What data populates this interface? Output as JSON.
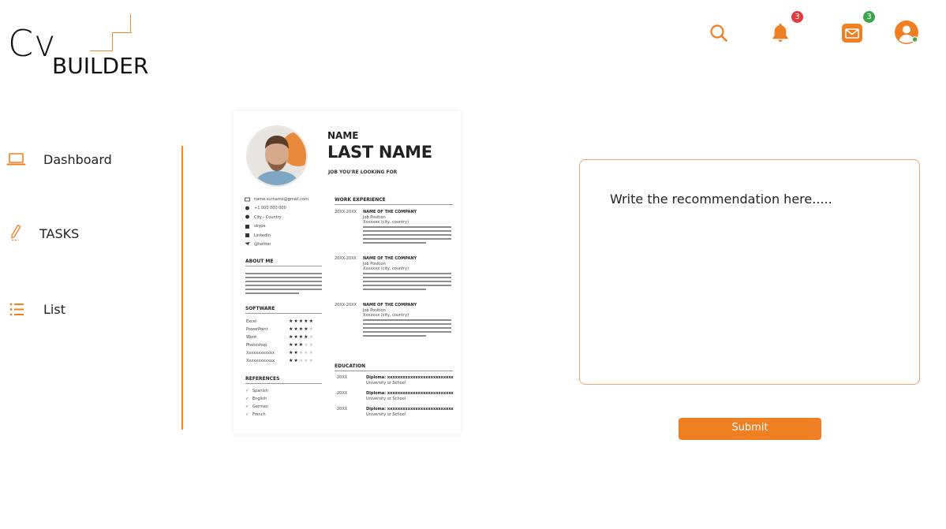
{
  "logo": {
    "text_main": "Cv",
    "text_sub": "BUILDER"
  },
  "header": {
    "notifications_count": "3",
    "messages_count": "3"
  },
  "sidebar": {
    "items": [
      {
        "label": "Dashboard",
        "icon": "laptop-icon"
      },
      {
        "label": "TASKS",
        "icon": "pencil-icon"
      },
      {
        "label": "List",
        "icon": "list-icon"
      }
    ]
  },
  "cv_preview": {
    "name": "NAME",
    "last_name": "LAST NAME",
    "job_title": "JOB YOU'RE LOOKING FOR",
    "contact": [
      "name.surname@gmail.com",
      "+1 000 000 000",
      "City - Country",
      "skype",
      "LinkedIn",
      "@twitter"
    ],
    "about_title": "ABOUT ME",
    "software_title": "SOFTWARE",
    "software": [
      {
        "name": "Excel",
        "stars": 5
      },
      {
        "name": "PowerPoint",
        "stars": 4
      },
      {
        "name": "Word",
        "stars": 4
      },
      {
        "name": "Photoshop",
        "stars": 3
      },
      {
        "name": "Xxxxxxxxxxxx",
        "stars": 2
      },
      {
        "name": "Xxxxxxxxxxxx",
        "stars": 2
      }
    ],
    "references_title": "REFERENCES",
    "references": [
      "Spanish",
      "English",
      "German",
      "French"
    ],
    "work_title": "WORK EXPERIENCE",
    "work_items": [
      {
        "date": "20XX-20XX",
        "company": "NAME OF THE COMPANY",
        "role": "Job Position",
        "place": "Xxxxxxx (city, country)"
      },
      {
        "date": "20XX-20XX",
        "company": "NAME OF THE COMPANY",
        "role": "Job Position",
        "place": "Xxxxxxx (city, country)"
      },
      {
        "date": "20XX-20XX",
        "company": "NAME OF THE COMPANY",
        "role": "Job Position",
        "place": "Xxxxxxx (city, country)"
      }
    ],
    "education_title": "EDUCATION",
    "education": [
      {
        "date": "20XX",
        "degree": "Diploma: xxxxxxxxxxxxxxxxxxxxxxxxxx",
        "school": "University or School"
      },
      {
        "date": "20XX",
        "degree": "Diploma: xxxxxxxxxxxxxxxxxxxxxxxxxx",
        "school": "University or School"
      },
      {
        "date": "20XX",
        "degree": "Diploma: xxxxxxxxxxxxxxxxxxxxxxxxxx",
        "school": "University or School"
      }
    ]
  },
  "recommendation": {
    "placeholder": "Write the recommendation here.....",
    "submit_label": "Submit"
  },
  "colors": {
    "accent": "#f07e22",
    "badge_red": "#e13b3b",
    "badge_green": "#3ca64a"
  }
}
